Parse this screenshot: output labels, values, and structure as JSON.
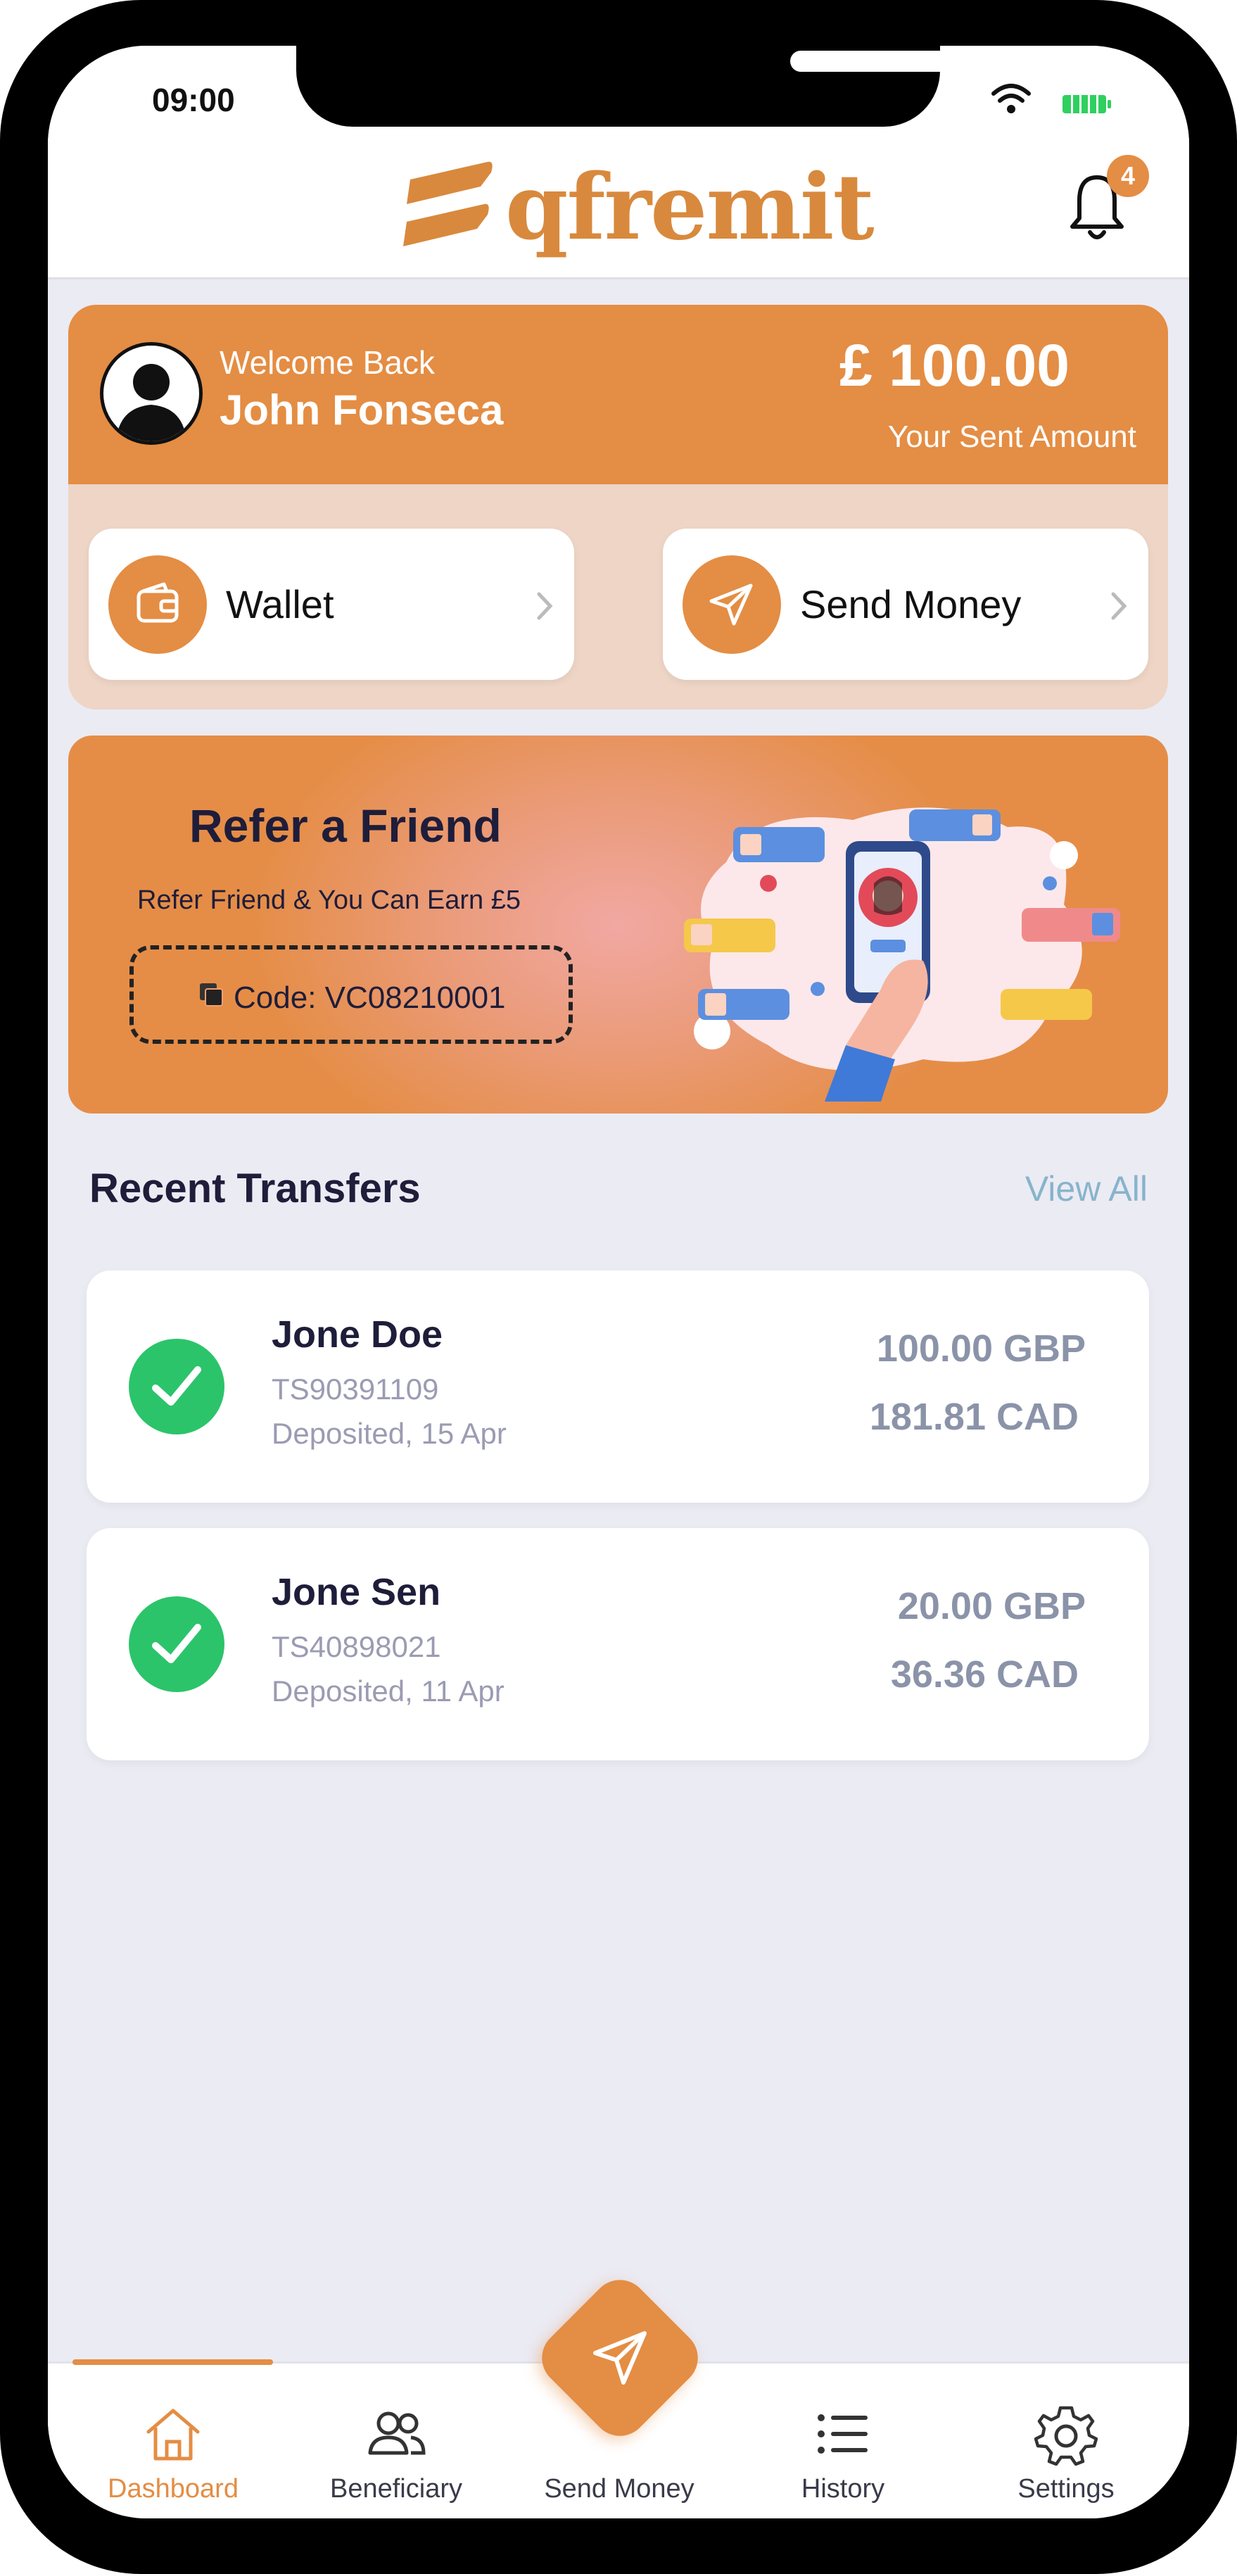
{
  "status_bar": {
    "time": "09:00"
  },
  "header": {
    "logo_text": "qfremit",
    "notification_count": "4"
  },
  "welcome": {
    "greeting": "Welcome Back",
    "name": "John Fonseca",
    "amount": "£ 100.00",
    "amount_label": "Your Sent Amount"
  },
  "quick_actions": [
    {
      "label": "Wallet",
      "icon": "wallet-icon"
    },
    {
      "label": "Send Money",
      "icon": "send-icon"
    }
  ],
  "refer": {
    "title": "Refer a Friend",
    "subtitle": "Refer Friend & You Can Earn £5",
    "code": "Code: VC08210001"
  },
  "recent_transfers": {
    "title": "Recent Transfers",
    "view_all": "View All",
    "items": [
      {
        "name": "Jone Doe",
        "ref": "TS90391109",
        "status": "Deposited, 15 Apr",
        "sent": "100.00 GBP",
        "received": "181.81 CAD"
      },
      {
        "name": "Jone Sen",
        "ref": "TS40898021",
        "status": "Deposited, 11 Apr",
        "sent": "20.00 GBP",
        "received": "36.36 CAD"
      }
    ]
  },
  "bottom_nav": {
    "items": [
      {
        "label": "Dashboard",
        "icon": "home-icon",
        "active": true
      },
      {
        "label": "Beneficiary",
        "icon": "users-icon",
        "active": false
      },
      {
        "label": "Send Money",
        "icon": "send-icon",
        "active": false
      },
      {
        "label": "History",
        "icon": "list-icon",
        "active": false
      },
      {
        "label": "Settings",
        "icon": "gear-icon",
        "active": false
      }
    ]
  },
  "colors": {
    "accent": "#e48d44",
    "success": "#2bc46a",
    "background": "#ebebf4",
    "text_dark": "#1e1d3a"
  }
}
